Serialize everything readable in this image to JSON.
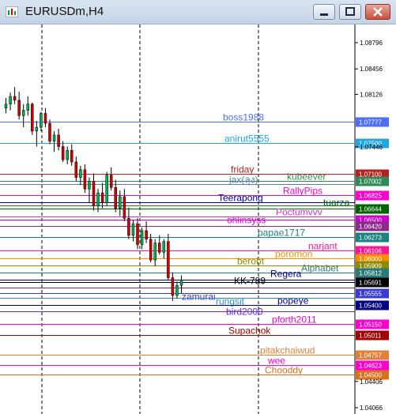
{
  "window": {
    "title": "EURUSDm,H4",
    "controls": {
      "minimize": "minimize",
      "maximize": "maximize",
      "close": "close"
    }
  },
  "colors": {
    "bull": "#00b050",
    "bear": "#d00000",
    "wick": "#000000",
    "grid": "#000000"
  },
  "axis": {
    "labels": [
      {
        "price": 1.08796,
        "text": "1.08796"
      },
      {
        "price": 1.08456,
        "text": "1.08456"
      },
      {
        "price": 1.08126,
        "text": "1.08126"
      },
      {
        "price": 1.07446,
        "text": "1.07446"
      },
      {
        "price": 1.04406,
        "text": "1.04406"
      },
      {
        "price": 1.04066,
        "text": "1.04066"
      }
    ]
  },
  "levels": [
    {
      "label": "boss1988",
      "price": 1.07777,
      "tag": "1.07777",
      "color": "#4f6ef7"
    },
    {
      "label": "anirut5555",
      "price": 1.075,
      "tag": "1.07500",
      "color": "#1ea7e0"
    },
    {
      "label": "friday",
      "price": 1.071,
      "tag": "1.07100",
      "color": "#b22222"
    },
    {
      "label": "kubeever",
      "price": 1.07002,
      "tag": "1.07002",
      "color": "#2e8b57"
    },
    {
      "label": "jax(ลุง)",
      "price": 1.0696,
      "tag": "",
      "color": "#5a7fa8"
    },
    {
      "label": "RallyPips",
      "price": 1.06825,
      "tag": "1.06825",
      "color": "#ff00cc"
    },
    {
      "label": "Teerapong",
      "price": 1.0673,
      "tag": "",
      "color": "#00008b"
    },
    {
      "label": "",
      "price": 1.0669,
      "tag": "",
      "color": "#1a7a1a"
    },
    {
      "label": "tuarza",
      "price": 1.06644,
      "tag": "1.06644",
      "color": "#006400"
    },
    {
      "label": "ohlinsyss",
      "price": 1.065,
      "tag": "1.06500",
      "color": "#cc00cc"
    },
    {
      "label": "Poctumvvv",
      "price": 1.0654,
      "tag": "",
      "color": "#cc33cc"
    },
    {
      "label": "",
      "price": 1.0642,
      "tag": "1.06420",
      "color": "#8b2a8b"
    },
    {
      "label": "papae1717",
      "price": 1.06273,
      "tag": "1.06273",
      "color": "#1f8080"
    },
    {
      "label": "narjant",
      "price": 1.06106,
      "tag": "1.06106",
      "color": "#ff1493"
    },
    {
      "label": "poromon",
      "price": 1.06,
      "tag": "1.06000",
      "color": "#ff8c00"
    },
    {
      "label": "berobt",
      "price": 1.05909,
      "tag": "1.05909",
      "color": "#8b8b00"
    },
    {
      "label": "Alphabet",
      "price": 1.05812,
      "tag": "1.05812",
      "color": "#2a7a7a"
    },
    {
      "label": "Regera",
      "price": 1.0572,
      "tag": "",
      "color": "#000080"
    },
    {
      "label": "KK-789",
      "price": 1.05691,
      "tag": "1.05691",
      "color": "#000000"
    },
    {
      "label": "",
      "price": 1.0562,
      "tag": "",
      "color": "#7a2a7a"
    },
    {
      "label": "zamurai",
      "price": 1.05555,
      "tag": "1.05555",
      "color": "#3a3ad0"
    },
    {
      "label": "rungsit",
      "price": 1.0549,
      "tag": "",
      "color": "#2a8fcc"
    },
    {
      "label": "popeye",
      "price": 1.054,
      "tag": "1.05400",
      "color": "#000080"
    },
    {
      "label": "bird2000",
      "price": 1.0532,
      "tag": "",
      "color": "#6a2acc"
    },
    {
      "label": "pforth2011",
      "price": 1.0515,
      "tag": "1.05150",
      "color": "#ff00cc"
    },
    {
      "label": "Supachok",
      "price": 1.05011,
      "tag": "1.05011",
      "color": "#a00000"
    },
    {
      "label": "pitakchaiwud",
      "price": 1.04757,
      "tag": "1.04757",
      "color": "#e0803a"
    },
    {
      "label": "wee",
      "price": 1.04623,
      "tag": "1.04623",
      "color": "#ff00cc"
    },
    {
      "label": "Chooddy",
      "price": 1.045,
      "tag": "1.04500",
      "color": "#d87020"
    }
  ],
  "candles": [
    [
      1.0795,
      1.0808,
      1.0788,
      1.08
    ],
    [
      1.08,
      1.0815,
      1.0792,
      1.081
    ],
    [
      1.081,
      1.0822,
      1.08,
      1.0805
    ],
    [
      1.0805,
      1.0816,
      1.078,
      1.0785
    ],
    [
      1.0785,
      1.08,
      1.077,
      1.0792
    ],
    [
      1.0792,
      1.081,
      1.0785,
      1.08
    ],
    [
      1.08,
      1.0802,
      1.076,
      1.0765
    ],
    [
      1.0765,
      1.0778,
      1.0745,
      1.077
    ],
    [
      1.077,
      1.079,
      1.0765,
      1.0788
    ],
    [
      1.0788,
      1.0795,
      1.077,
      1.0775
    ],
    [
      1.0775,
      1.078,
      1.0748,
      1.0752
    ],
    [
      1.0752,
      1.0765,
      1.0738,
      1.076
    ],
    [
      1.076,
      1.0768,
      1.074,
      1.0745
    ],
    [
      1.0745,
      1.0752,
      1.0725,
      1.0728
    ],
    [
      1.0728,
      1.0745,
      1.0722,
      1.074
    ],
    [
      1.074,
      1.0748,
      1.072,
      1.0725
    ],
    [
      1.0725,
      1.0732,
      1.07,
      1.0705
    ],
    [
      1.0705,
      1.072,
      1.0695,
      1.0715
    ],
    [
      1.0715,
      1.0722,
      1.0685,
      1.069
    ],
    [
      1.069,
      1.0705,
      1.0672,
      1.07
    ],
    [
      1.07,
      1.071,
      1.0662,
      1.0668
    ],
    [
      1.0668,
      1.069,
      1.066,
      1.0685
    ],
    [
      1.0685,
      1.0698,
      1.0665,
      1.0672
    ],
    [
      1.0672,
      1.0712,
      1.0668,
      1.0708
    ],
    [
      1.0708,
      1.0718,
      1.0688,
      1.0692
    ],
    [
      1.0692,
      1.0702,
      1.066,
      1.0665
    ],
    [
      1.0665,
      1.0688,
      1.0655,
      1.068
    ],
    [
      1.068,
      1.069,
      1.0648,
      1.0652
    ],
    [
      1.0652,
      1.0666,
      1.0625,
      1.063
    ],
    [
      1.063,
      1.065,
      1.0622,
      1.0645
    ],
    [
      1.0645,
      1.0652,
      1.0612,
      1.0618
    ],
    [
      1.0618,
      1.064,
      1.0612,
      1.0636
    ],
    [
      1.0636,
      1.0648,
      1.062,
      1.0625
    ],
    [
      1.0625,
      1.0632,
      1.0595,
      1.0598
    ],
    [
      1.0598,
      1.0625,
      1.059,
      1.062
    ],
    [
      1.062,
      1.063,
      1.0605,
      1.0608
    ],
    [
      1.0608,
      1.0625,
      1.06,
      1.0622
    ],
    [
      1.0622,
      1.0632,
      1.0572,
      1.0575
    ],
    [
      1.0575,
      1.0582,
      1.0545,
      1.0552
    ],
    [
      1.0552,
      1.057,
      1.0548,
      1.0565
    ],
    [
      1.0565,
      1.0578,
      1.0555,
      1.0572
    ]
  ]
}
